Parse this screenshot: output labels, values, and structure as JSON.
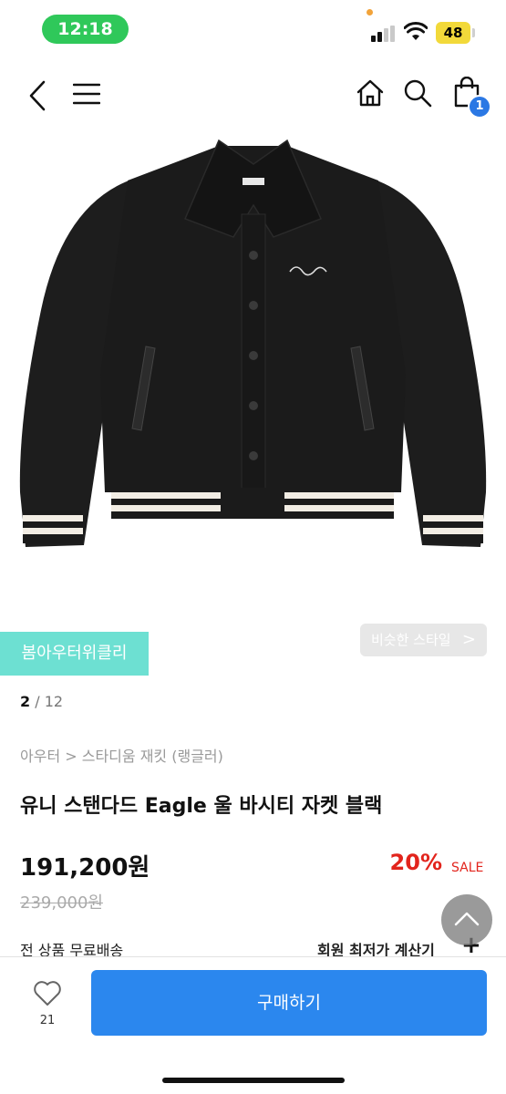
{
  "status_bar": {
    "time": "12:18",
    "battery": "48"
  },
  "nav": {
    "cart_count": "1"
  },
  "product_image": {
    "alt": "varsity jacket photo",
    "main_color": "#1b1b1b",
    "stripe_color": "#f2ede4"
  },
  "brand_tag": {
    "label": "봄아우터위클리",
    "color": "#6de0d2"
  },
  "similar_style": {
    "label": "비슷한 스타일",
    "chevron": ">"
  },
  "pager": {
    "current": "2",
    "separator": " / ",
    "total": "12"
  },
  "breadcrumb": "아우터 > 스타디움 재킷 (랭글러)",
  "product": {
    "title": "유니 스탠다드 Eagle 울 바시티 자켓 블랙",
    "price": "191,200원",
    "original_price": "239,000원",
    "discount": "20%",
    "sale_label": "SALE"
  },
  "shipping": {
    "free_label": "전 상품 무료배송",
    "calculator_label": "회원 최저가 계산기",
    "calculator_icon": "+"
  },
  "bottom_bar": {
    "like_count": "21",
    "buy_label": "구매하기"
  },
  "colors": {
    "accent": "#2b87ee",
    "sale": "#e2241c",
    "badge": "#2b78e4"
  }
}
